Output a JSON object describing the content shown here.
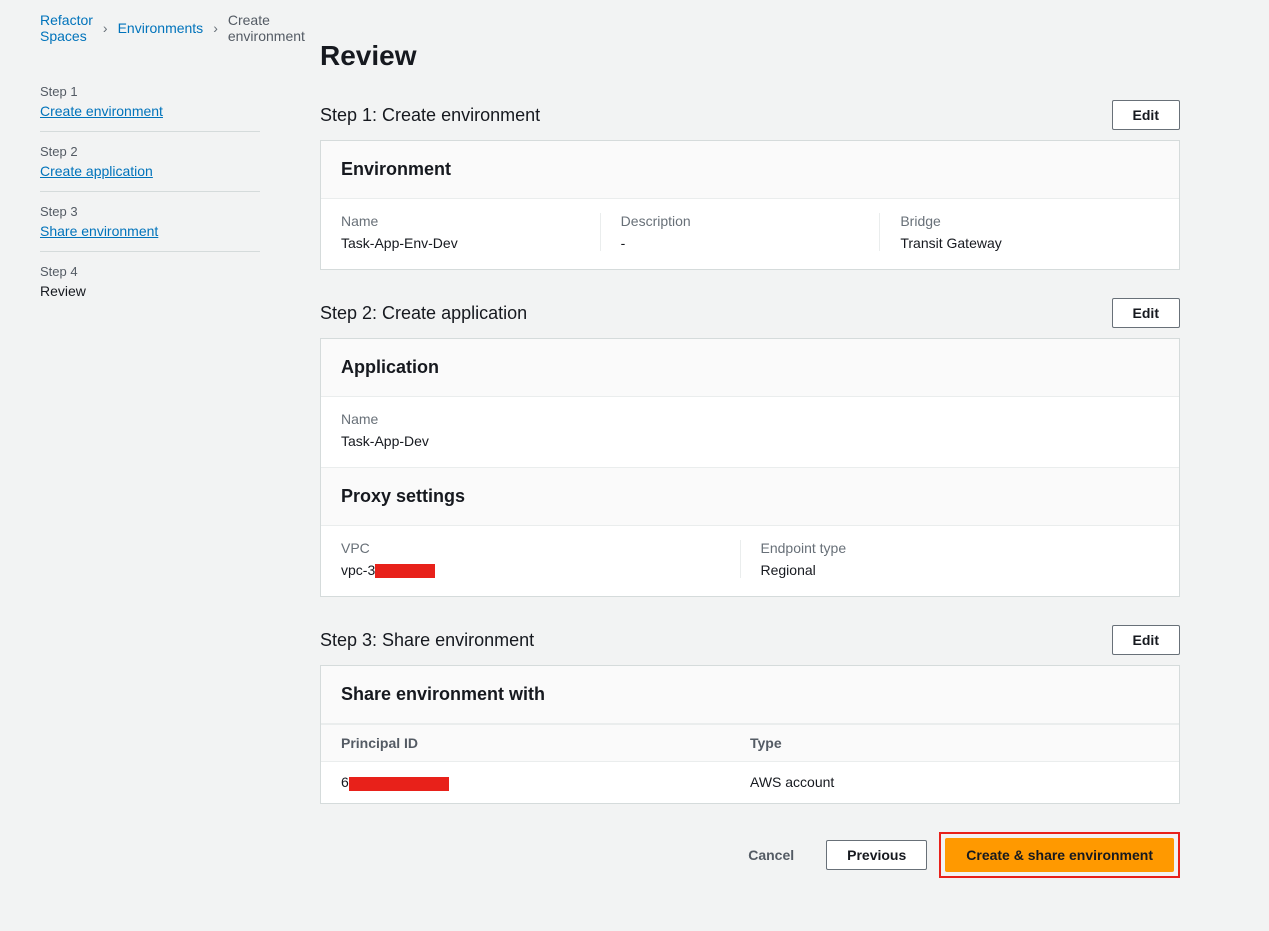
{
  "breadcrumb": {
    "root": "Refactor Spaces",
    "env": "Environments",
    "current": "Create environment"
  },
  "sidebar": {
    "steps": [
      {
        "num": "Step 1",
        "label": "Create environment",
        "active": false
      },
      {
        "num": "Step 2",
        "label": "Create application",
        "active": false
      },
      {
        "num": "Step 3",
        "label": "Share environment",
        "active": false
      },
      {
        "num": "Step 4",
        "label": "Review",
        "active": true
      }
    ]
  },
  "page": {
    "title": "Review"
  },
  "step1": {
    "heading": "Step 1: Create environment",
    "edit": "Edit",
    "panel_title": "Environment",
    "name_label": "Name",
    "name_value": "Task-App-Env-Dev",
    "desc_label": "Description",
    "desc_value": "-",
    "bridge_label": "Bridge",
    "bridge_value": "Transit Gateway"
  },
  "step2": {
    "heading": "Step 2: Create application",
    "edit": "Edit",
    "panel_title": "Application",
    "name_label": "Name",
    "name_value": "Task-App-Dev",
    "proxy_title": "Proxy settings",
    "vpc_label": "VPC",
    "vpc_prefix": "vpc-3",
    "endpoint_label": "Endpoint type",
    "endpoint_value": "Regional"
  },
  "step3": {
    "heading": "Step 3: Share environment",
    "edit": "Edit",
    "panel_title": "Share environment with",
    "col_principal": "Principal ID",
    "col_type": "Type",
    "row_principal_prefix": "6",
    "row_type": "AWS account"
  },
  "footer": {
    "cancel": "Cancel",
    "previous": "Previous",
    "create": "Create & share environment"
  }
}
